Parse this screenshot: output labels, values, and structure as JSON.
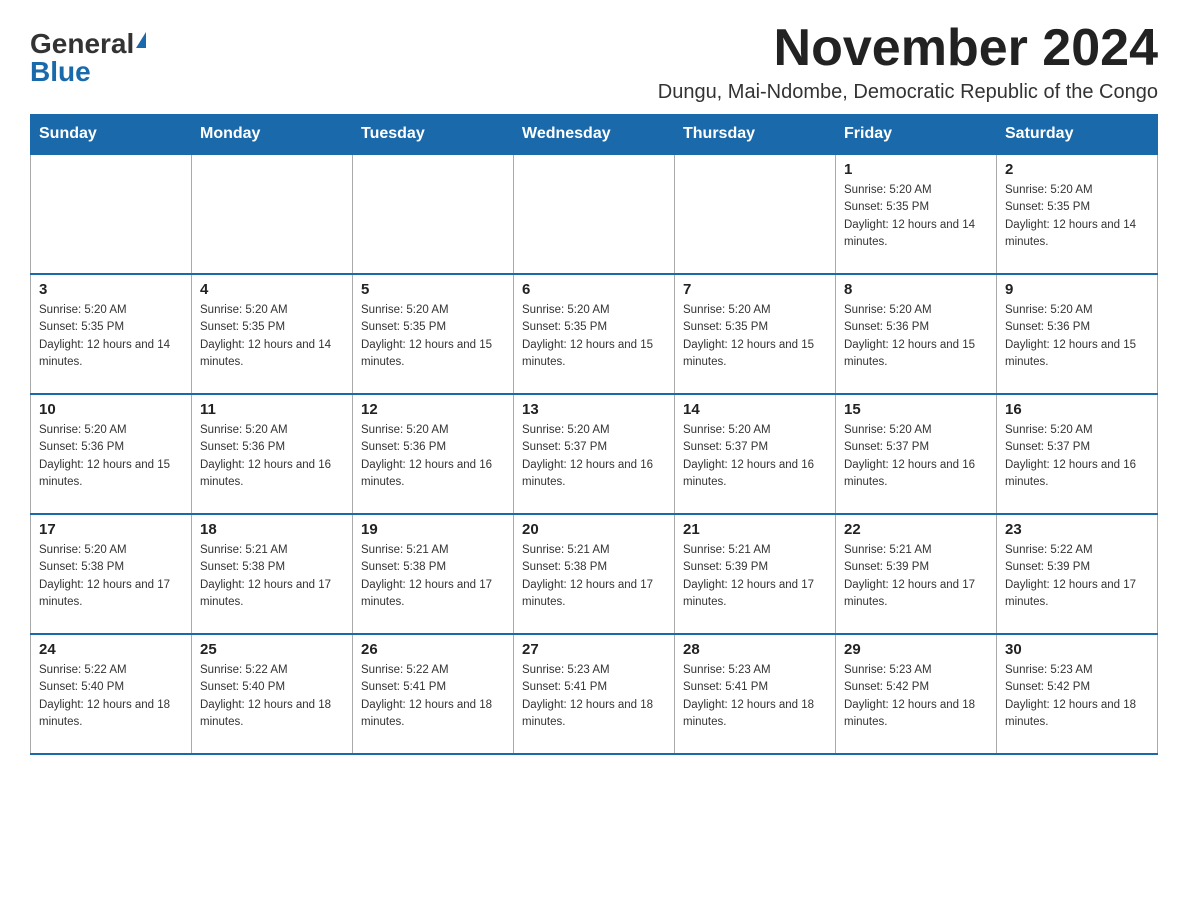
{
  "header": {
    "logo_general": "General",
    "logo_blue": "Blue",
    "month_title": "November 2024",
    "subtitle": "Dungu, Mai-Ndombe, Democratic Republic of the Congo"
  },
  "days_of_week": [
    "Sunday",
    "Monday",
    "Tuesday",
    "Wednesday",
    "Thursday",
    "Friday",
    "Saturday"
  ],
  "weeks": [
    [
      {
        "day": "",
        "sunrise": "",
        "sunset": "",
        "daylight": ""
      },
      {
        "day": "",
        "sunrise": "",
        "sunset": "",
        "daylight": ""
      },
      {
        "day": "",
        "sunrise": "",
        "sunset": "",
        "daylight": ""
      },
      {
        "day": "",
        "sunrise": "",
        "sunset": "",
        "daylight": ""
      },
      {
        "day": "",
        "sunrise": "",
        "sunset": "",
        "daylight": ""
      },
      {
        "day": "1",
        "sunrise": "Sunrise: 5:20 AM",
        "sunset": "Sunset: 5:35 PM",
        "daylight": "Daylight: 12 hours and 14 minutes."
      },
      {
        "day": "2",
        "sunrise": "Sunrise: 5:20 AM",
        "sunset": "Sunset: 5:35 PM",
        "daylight": "Daylight: 12 hours and 14 minutes."
      }
    ],
    [
      {
        "day": "3",
        "sunrise": "Sunrise: 5:20 AM",
        "sunset": "Sunset: 5:35 PM",
        "daylight": "Daylight: 12 hours and 14 minutes."
      },
      {
        "day": "4",
        "sunrise": "Sunrise: 5:20 AM",
        "sunset": "Sunset: 5:35 PM",
        "daylight": "Daylight: 12 hours and 14 minutes."
      },
      {
        "day": "5",
        "sunrise": "Sunrise: 5:20 AM",
        "sunset": "Sunset: 5:35 PM",
        "daylight": "Daylight: 12 hours and 15 minutes."
      },
      {
        "day": "6",
        "sunrise": "Sunrise: 5:20 AM",
        "sunset": "Sunset: 5:35 PM",
        "daylight": "Daylight: 12 hours and 15 minutes."
      },
      {
        "day": "7",
        "sunrise": "Sunrise: 5:20 AM",
        "sunset": "Sunset: 5:35 PM",
        "daylight": "Daylight: 12 hours and 15 minutes."
      },
      {
        "day": "8",
        "sunrise": "Sunrise: 5:20 AM",
        "sunset": "Sunset: 5:36 PM",
        "daylight": "Daylight: 12 hours and 15 minutes."
      },
      {
        "day": "9",
        "sunrise": "Sunrise: 5:20 AM",
        "sunset": "Sunset: 5:36 PM",
        "daylight": "Daylight: 12 hours and 15 minutes."
      }
    ],
    [
      {
        "day": "10",
        "sunrise": "Sunrise: 5:20 AM",
        "sunset": "Sunset: 5:36 PM",
        "daylight": "Daylight: 12 hours and 15 minutes."
      },
      {
        "day": "11",
        "sunrise": "Sunrise: 5:20 AM",
        "sunset": "Sunset: 5:36 PM",
        "daylight": "Daylight: 12 hours and 16 minutes."
      },
      {
        "day": "12",
        "sunrise": "Sunrise: 5:20 AM",
        "sunset": "Sunset: 5:36 PM",
        "daylight": "Daylight: 12 hours and 16 minutes."
      },
      {
        "day": "13",
        "sunrise": "Sunrise: 5:20 AM",
        "sunset": "Sunset: 5:37 PM",
        "daylight": "Daylight: 12 hours and 16 minutes."
      },
      {
        "day": "14",
        "sunrise": "Sunrise: 5:20 AM",
        "sunset": "Sunset: 5:37 PM",
        "daylight": "Daylight: 12 hours and 16 minutes."
      },
      {
        "day": "15",
        "sunrise": "Sunrise: 5:20 AM",
        "sunset": "Sunset: 5:37 PM",
        "daylight": "Daylight: 12 hours and 16 minutes."
      },
      {
        "day": "16",
        "sunrise": "Sunrise: 5:20 AM",
        "sunset": "Sunset: 5:37 PM",
        "daylight": "Daylight: 12 hours and 16 minutes."
      }
    ],
    [
      {
        "day": "17",
        "sunrise": "Sunrise: 5:20 AM",
        "sunset": "Sunset: 5:38 PM",
        "daylight": "Daylight: 12 hours and 17 minutes."
      },
      {
        "day": "18",
        "sunrise": "Sunrise: 5:21 AM",
        "sunset": "Sunset: 5:38 PM",
        "daylight": "Daylight: 12 hours and 17 minutes."
      },
      {
        "day": "19",
        "sunrise": "Sunrise: 5:21 AM",
        "sunset": "Sunset: 5:38 PM",
        "daylight": "Daylight: 12 hours and 17 minutes."
      },
      {
        "day": "20",
        "sunrise": "Sunrise: 5:21 AM",
        "sunset": "Sunset: 5:38 PM",
        "daylight": "Daylight: 12 hours and 17 minutes."
      },
      {
        "day": "21",
        "sunrise": "Sunrise: 5:21 AM",
        "sunset": "Sunset: 5:39 PM",
        "daylight": "Daylight: 12 hours and 17 minutes."
      },
      {
        "day": "22",
        "sunrise": "Sunrise: 5:21 AM",
        "sunset": "Sunset: 5:39 PM",
        "daylight": "Daylight: 12 hours and 17 minutes."
      },
      {
        "day": "23",
        "sunrise": "Sunrise: 5:22 AM",
        "sunset": "Sunset: 5:39 PM",
        "daylight": "Daylight: 12 hours and 17 minutes."
      }
    ],
    [
      {
        "day": "24",
        "sunrise": "Sunrise: 5:22 AM",
        "sunset": "Sunset: 5:40 PM",
        "daylight": "Daylight: 12 hours and 18 minutes."
      },
      {
        "day": "25",
        "sunrise": "Sunrise: 5:22 AM",
        "sunset": "Sunset: 5:40 PM",
        "daylight": "Daylight: 12 hours and 18 minutes."
      },
      {
        "day": "26",
        "sunrise": "Sunrise: 5:22 AM",
        "sunset": "Sunset: 5:41 PM",
        "daylight": "Daylight: 12 hours and 18 minutes."
      },
      {
        "day": "27",
        "sunrise": "Sunrise: 5:23 AM",
        "sunset": "Sunset: 5:41 PM",
        "daylight": "Daylight: 12 hours and 18 minutes."
      },
      {
        "day": "28",
        "sunrise": "Sunrise: 5:23 AM",
        "sunset": "Sunset: 5:41 PM",
        "daylight": "Daylight: 12 hours and 18 minutes."
      },
      {
        "day": "29",
        "sunrise": "Sunrise: 5:23 AM",
        "sunset": "Sunset: 5:42 PM",
        "daylight": "Daylight: 12 hours and 18 minutes."
      },
      {
        "day": "30",
        "sunrise": "Sunrise: 5:23 AM",
        "sunset": "Sunset: 5:42 PM",
        "daylight": "Daylight: 12 hours and 18 minutes."
      }
    ]
  ]
}
